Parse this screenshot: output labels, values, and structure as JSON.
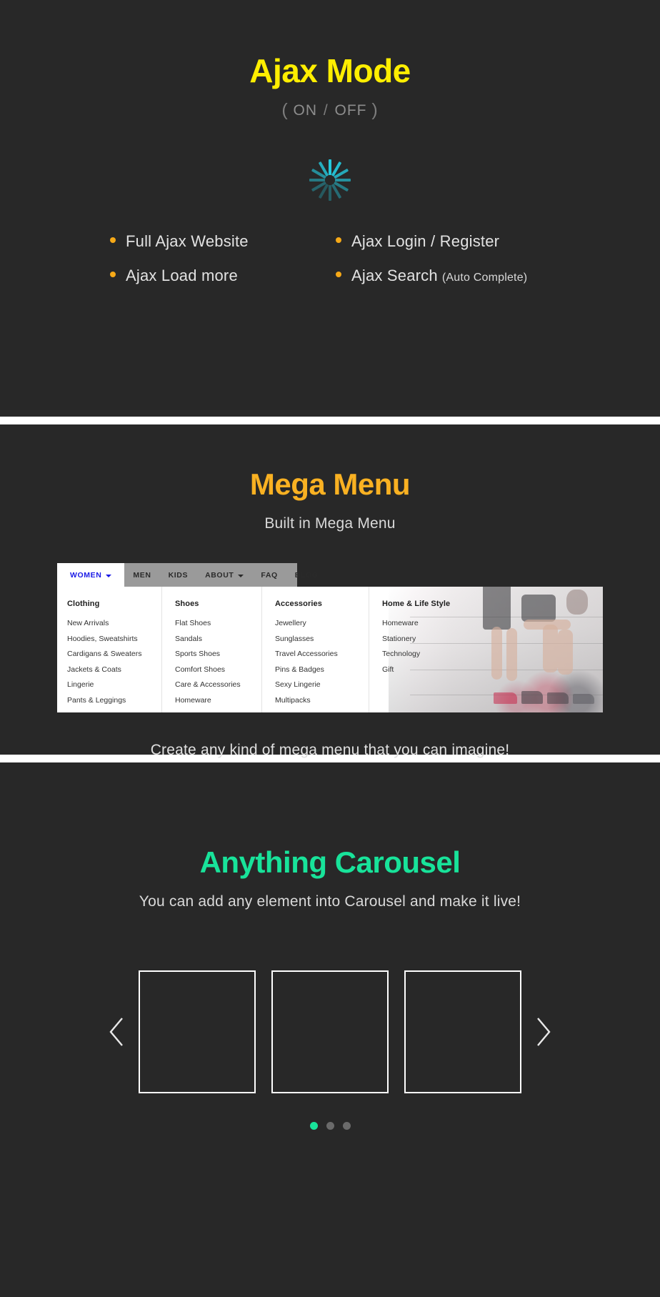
{
  "sections": {
    "ajax": {
      "title": "Ajax Mode",
      "title_color": "#ffee00",
      "subtitle_open": "(",
      "subtitle_on": "ON",
      "subtitle_slash": "/",
      "subtitle_off": "OFF",
      "subtitle_close": ")",
      "spinner_color": "#24c9dd",
      "bullet_color": "#f6a917",
      "features_left": [
        {
          "label": "Full Ajax Website",
          "note": ""
        },
        {
          "label": "Ajax Load more",
          "note": ""
        }
      ],
      "features_right": [
        {
          "label": "Ajax Login / Register",
          "note": ""
        },
        {
          "label": "Ajax Search",
          "note": "(Auto Complete)"
        }
      ]
    },
    "mega": {
      "title": "Mega Menu",
      "title_color": "#f9b122",
      "lead": "Built in Mega Menu",
      "closing": "Create any kind of mega menu that you can imagine!",
      "nav": [
        {
          "label": "WOMEN",
          "active": true,
          "caret": true
        },
        {
          "label": "MEN",
          "active": false,
          "caret": false
        },
        {
          "label": "KIDS",
          "active": false,
          "caret": false
        },
        {
          "label": "ABOUT",
          "active": false,
          "caret": true
        },
        {
          "label": "FAQ",
          "active": false,
          "caret": false
        },
        {
          "label": "BLOG",
          "active": false,
          "caret": false
        }
      ],
      "columns": [
        {
          "heading": "Clothing",
          "links": [
            "New Arrivals",
            "Hoodies, Sweatshirts",
            "Cardigans & Sweaters",
            "Jackets & Coats",
            "Lingerie",
            "Pants & Leggings"
          ]
        },
        {
          "heading": "Shoes",
          "links": [
            "Flat Shoes",
            "Sandals",
            "Sports Shoes",
            "Comfort Shoes",
            "Care & Accessories",
            "Homeware"
          ]
        },
        {
          "heading": "Accessories",
          "links": [
            "Jewellery",
            "Sunglasses",
            "Travel Accessories",
            "Pins & Badges",
            "Sexy Lingerie",
            "Multipacks"
          ]
        },
        {
          "heading": "Home & Life Style",
          "links": [
            "Homeware",
            "Stationery",
            "Technology",
            "Gift"
          ]
        }
      ]
    },
    "carousel": {
      "title": "Anything Carousel",
      "title_color": "#18e39a",
      "lead": "You can add any element into Carousel and make it live!",
      "prev_icon": "chevron-left-icon",
      "next_icon": "chevron-right-icon",
      "slides": [
        "",
        "",
        ""
      ],
      "dots": [
        {
          "active": true
        },
        {
          "active": false
        },
        {
          "active": false
        }
      ],
      "active_dot_color": "#18e39a"
    }
  }
}
